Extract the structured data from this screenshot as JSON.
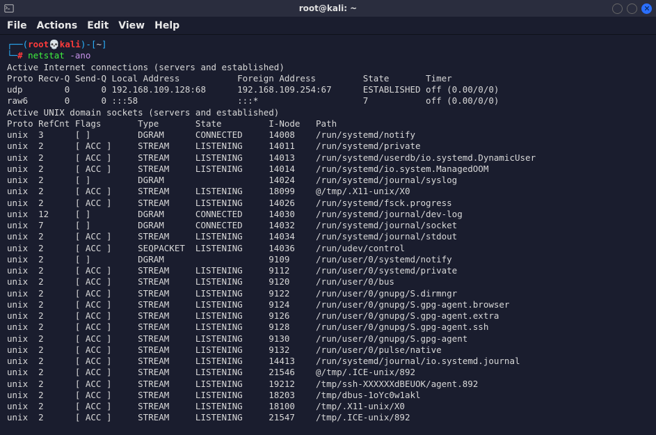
{
  "titlebar": {
    "title": "root@kali: ~"
  },
  "menubar": {
    "items": [
      "File",
      "Actions",
      "Edit",
      "View",
      "Help"
    ]
  },
  "prompt": {
    "open": "┌──(",
    "user": "root",
    "at": "💀",
    "host": "kali",
    "close": ")-[",
    "cwd": "~",
    "end": "]",
    "line2_prefix": "└─",
    "hash": "#",
    "cmd": "netstat",
    "args": "-ano"
  },
  "header_net": "Active Internet connections (servers and established)",
  "col_net": "Proto Recv-Q Send-Q Local Address           Foreign Address         State       Timer",
  "net_rows": [
    "udp        0      0 192.168.109.128:68      192.168.109.254:67      ESTABLISHED off (0.00/0/0)",
    "raw6       0      0 :::58                   :::*                    7           off (0.00/0/0)"
  ],
  "header_unix": "Active UNIX domain sockets (servers and established)",
  "col_unix": "Proto RefCnt Flags       Type       State         I-Node   Path",
  "unix_rows": [
    "unix  3      [ ]         DGRAM      CONNECTED     14008    /run/systemd/notify",
    "unix  2      [ ACC ]     STREAM     LISTENING     14011    /run/systemd/private",
    "unix  2      [ ACC ]     STREAM     LISTENING     14013    /run/systemd/userdb/io.systemd.DynamicUser",
    "unix  2      [ ACC ]     STREAM     LISTENING     14014    /run/systemd/io.system.ManagedOOM",
    "unix  2      [ ]         DGRAM                    14024    /run/systemd/journal/syslog",
    "unix  2      [ ACC ]     STREAM     LISTENING     18099    @/tmp/.X11-unix/X0",
    "unix  2      [ ACC ]     STREAM     LISTENING     14026    /run/systemd/fsck.progress",
    "unix  12     [ ]         DGRAM      CONNECTED     14030    /run/systemd/journal/dev-log",
    "unix  7      [ ]         DGRAM      CONNECTED     14032    /run/systemd/journal/socket",
    "unix  2      [ ACC ]     STREAM     LISTENING     14034    /run/systemd/journal/stdout",
    "unix  2      [ ACC ]     SEQPACKET  LISTENING     14036    /run/udev/control",
    "unix  2      [ ]         DGRAM                    9109     /run/user/0/systemd/notify",
    "unix  2      [ ACC ]     STREAM     LISTENING     9112     /run/user/0/systemd/private",
    "unix  2      [ ACC ]     STREAM     LISTENING     9120     /run/user/0/bus",
    "unix  2      [ ACC ]     STREAM     LISTENING     9122     /run/user/0/gnupg/S.dirmngr",
    "unix  2      [ ACC ]     STREAM     LISTENING     9124     /run/user/0/gnupg/S.gpg-agent.browser",
    "unix  2      [ ACC ]     STREAM     LISTENING     9126     /run/user/0/gnupg/S.gpg-agent.extra",
    "unix  2      [ ACC ]     STREAM     LISTENING     9128     /run/user/0/gnupg/S.gpg-agent.ssh",
    "unix  2      [ ACC ]     STREAM     LISTENING     9130     /run/user/0/gnupg/S.gpg-agent",
    "unix  2      [ ACC ]     STREAM     LISTENING     9132     /run/user/0/pulse/native",
    "unix  2      [ ACC ]     STREAM     LISTENING     14413    /run/systemd/journal/io.systemd.journal",
    "unix  2      [ ACC ]     STREAM     LISTENING     21546    @/tmp/.ICE-unix/892",
    "unix  2      [ ACC ]     STREAM     LISTENING     19212    /tmp/ssh-XXXXXXdBEUOK/agent.892",
    "unix  2      [ ACC ]     STREAM     LISTENING     18203    /tmp/dbus-1oYc0w1akl",
    "unix  2      [ ACC ]     STREAM     LISTENING     18100    /tmp/.X11-unix/X0",
    "unix  2      [ ACC ]     STREAM     LISTENING     21547    /tmp/.ICE-unix/892"
  ]
}
